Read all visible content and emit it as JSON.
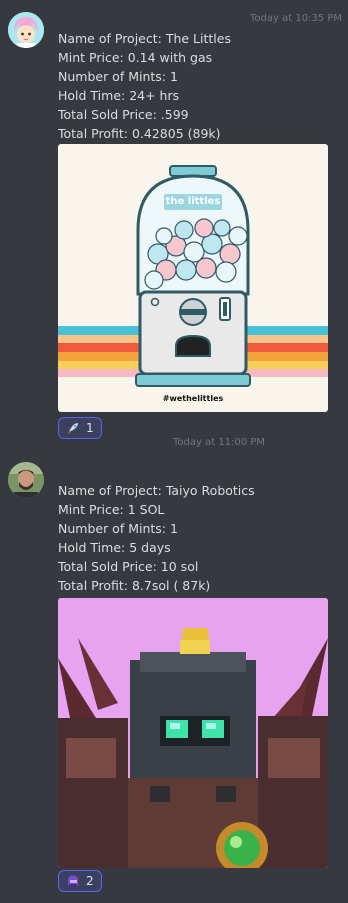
{
  "messages": [
    {
      "timestamp": "Today at 10:35 PM",
      "lines": [
        "Name of Project: The Littles",
        "Mint Price: 0.14 with gas",
        "Number of Mints: 1",
        "Hold Time: 24+ hrs",
        "Total Sold Price: .599",
        "Total Profit: 0.42805 (89k)"
      ],
      "image_banner": "the littles",
      "image_tag": "#wethelittles",
      "reaction": {
        "emoji": "rocket-emoji",
        "count": "1"
      }
    },
    {
      "timestamp": "Today at 11:00 PM",
      "lines": [
        "Name of Project: Taiyo Robotics",
        "Mint Price: 1 SOL",
        "Number of Mints: 1",
        "Hold Time:  5 days",
        "Total Sold Price:  10 sol",
        "Total Profit: 8.7sol ( 87k)"
      ],
      "reaction": {
        "emoji": "robot-helmet-emoji",
        "count": "2"
      }
    }
  ],
  "colors": {
    "background": "#36393f",
    "text": "#dcddde",
    "timestamp": "#72767d",
    "reaction_border": "#5865f2"
  }
}
